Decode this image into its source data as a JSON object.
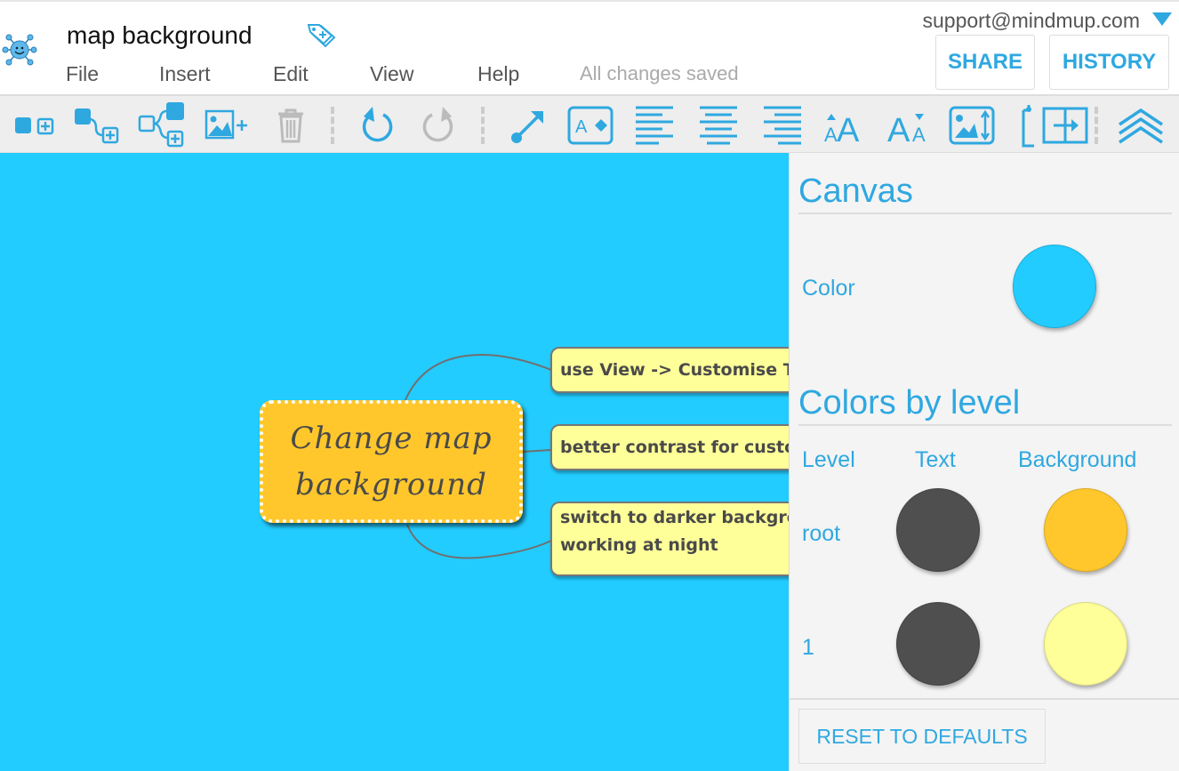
{
  "header": {
    "title": "map background",
    "menu": [
      "File",
      "Insert",
      "Edit",
      "View",
      "Help"
    ],
    "status": "All changes saved",
    "user": "support@mindmup.com",
    "share_label": "SHARE",
    "history_label": "HISTORY"
  },
  "toolbar": {
    "icons": [
      "add-sibling",
      "add-child",
      "add-subtree",
      "add-image",
      "delete",
      "undo",
      "redo",
      "connect",
      "text-style",
      "align-left",
      "align-center",
      "align-right",
      "increase-font",
      "decrease-font",
      "image-resize",
      "column-width",
      "expand-panel",
      "collapse-toolbar"
    ]
  },
  "map": {
    "root": "Change map background",
    "children": [
      "use View -> Customise Th",
      "better contrast for custo",
      "switch to darker backgro",
      "working at night"
    ]
  },
  "panel": {
    "canvas_heading": "Canvas",
    "color_label": "Color",
    "levels_heading": "Colors by level",
    "col_level": "Level",
    "col_text": "Text",
    "col_background": "Background",
    "rows": [
      {
        "level": "root",
        "text": "#4f4f4f",
        "background": "#ffc72c"
      },
      {
        "level": "1",
        "text": "#4f4f4f",
        "background": "#ffff99"
      }
    ],
    "reset_label": "RESET TO DEFAULTS"
  },
  "colors": {
    "accent": "#2fa8e0",
    "canvas": "#22ccff"
  }
}
